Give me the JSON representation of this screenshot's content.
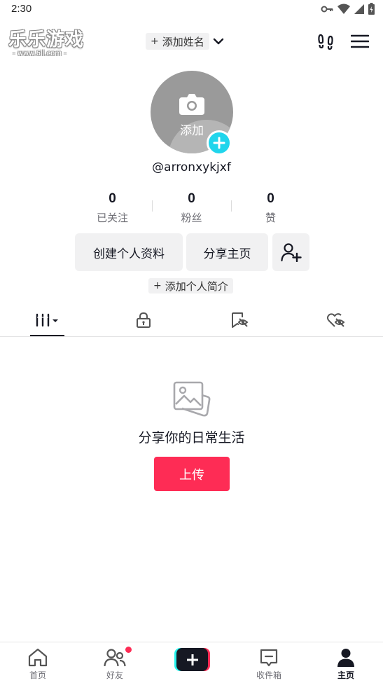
{
  "status_bar": {
    "time": "2:30",
    "icons": [
      "key-icon",
      "wifi-icon",
      "signal-icon",
      "battery-charging-icon"
    ]
  },
  "watermark": {
    "title": "乐乐游戏",
    "url": "- www.6ll.com -"
  },
  "header": {
    "add_name_plus": "+",
    "add_name_label": "添加姓名",
    "icons": [
      "chevron-down-icon",
      "footprints-icon",
      "menu-icon"
    ]
  },
  "profile": {
    "avatar_label": "添加",
    "username": "@arronxykjxf",
    "stats": [
      {
        "value": "0",
        "label": "已关注"
      },
      {
        "value": "0",
        "label": "粉丝"
      },
      {
        "value": "0",
        "label": "赞"
      }
    ],
    "edit_profile_label": "创建个人资料",
    "share_profile_label": "分享主页",
    "bio_plus": "+",
    "bio_label": "添加个人简介"
  },
  "tabs": [
    "videos-grid-icon",
    "lock-icon",
    "bookmark-hidden-icon",
    "liked-hidden-icon"
  ],
  "empty_state": {
    "title": "分享你的日常生活",
    "upload_label": "上传"
  },
  "bottom_nav": {
    "items": [
      {
        "label": "首页",
        "icon": "home-icon"
      },
      {
        "label": "好友",
        "icon": "friends-icon"
      },
      {
        "label": "",
        "icon": "create-plus-icon"
      },
      {
        "label": "收件箱",
        "icon": "inbox-icon"
      },
      {
        "label": "主页",
        "icon": "profile-icon"
      }
    ],
    "active": "主页"
  },
  "colors": {
    "accent": "#fe2c55",
    "cyan": "#20d5ec",
    "text": "#161823",
    "muted": "#6e6e75",
    "chip_bg": "#f1f1f2"
  }
}
